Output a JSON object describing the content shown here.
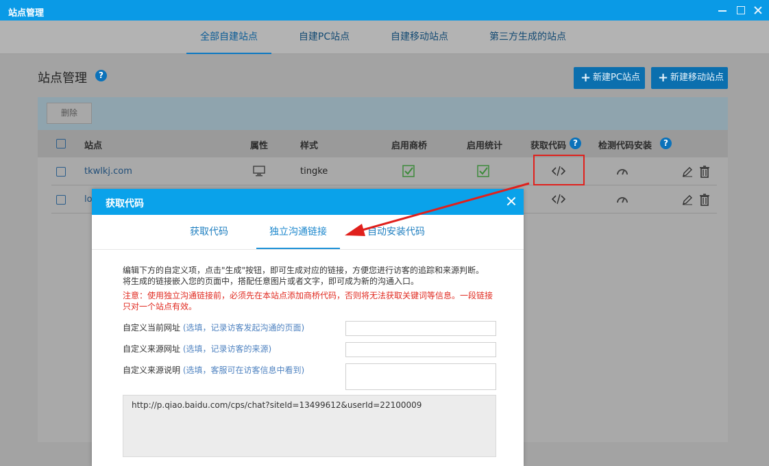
{
  "window": {
    "title": "站点管理"
  },
  "main_tabs": [
    {
      "label": "全部自建站点",
      "active": true
    },
    {
      "label": "自建PC站点"
    },
    {
      "label": "自建移动站点"
    },
    {
      "label": "第三方生成的站点"
    }
  ],
  "page": {
    "title": "站点管理",
    "help": "?",
    "new_pc_label": "新建PC站点",
    "new_mobile_label": "新建移动站点",
    "delete_label": "删除"
  },
  "table": {
    "headers": {
      "site": "站点",
      "type": "属性",
      "style": "样式",
      "shangqiao": "启用商桥",
      "stats": "启用统计",
      "get_code": "获取代码",
      "check_install": "检测代码安装"
    },
    "rows": [
      {
        "site": "tkwlkj.com",
        "type_icon": "monitor-icon",
        "style": "tingke",
        "shangqiao": "checked",
        "stats": "checked"
      },
      {
        "site": "lo",
        "type_icon": "",
        "style": "",
        "shangqiao": "",
        "stats": ""
      }
    ]
  },
  "dialog": {
    "title": "获取代码",
    "tabs": [
      {
        "label": "获取代码"
      },
      {
        "label": "独立沟通链接",
        "active": true
      },
      {
        "label": "自动安装代码"
      }
    ],
    "desc_line1": "编辑下方的自定义项，点击\"生成\"按钮，即可生成对应的链接，方便您进行访客的追踪和来源判断。",
    "desc_line2": "将生成的链接嵌入您的页面中，搭配任意图片或者文字，即可成为新的沟通入口。",
    "note_line1": "注意：使用独立沟通链接前，必须先在本站点添加商桥代码，否则将无法获取关键词等信息。一段链接",
    "note_line2": "只对一个站点有效。",
    "fields": [
      {
        "label": "自定义当前网址",
        "hint": "(选填，记录访客发起沟通的页面)",
        "value": ""
      },
      {
        "label": "自定义来源网址",
        "hint": "(选填，记录访客的来源)",
        "value": ""
      },
      {
        "label": "自定义来源说明",
        "hint": "(选填，客服可在访客信息中看到)",
        "value": ""
      }
    ],
    "result": "http://p.qiao.baidu.com/cps/chat?siteId=13499612&userId=22100009"
  },
  "colors": {
    "header_blue": "#0aa2ea",
    "highlight_red": "#e0201c",
    "check_green": "#3ea83b"
  }
}
